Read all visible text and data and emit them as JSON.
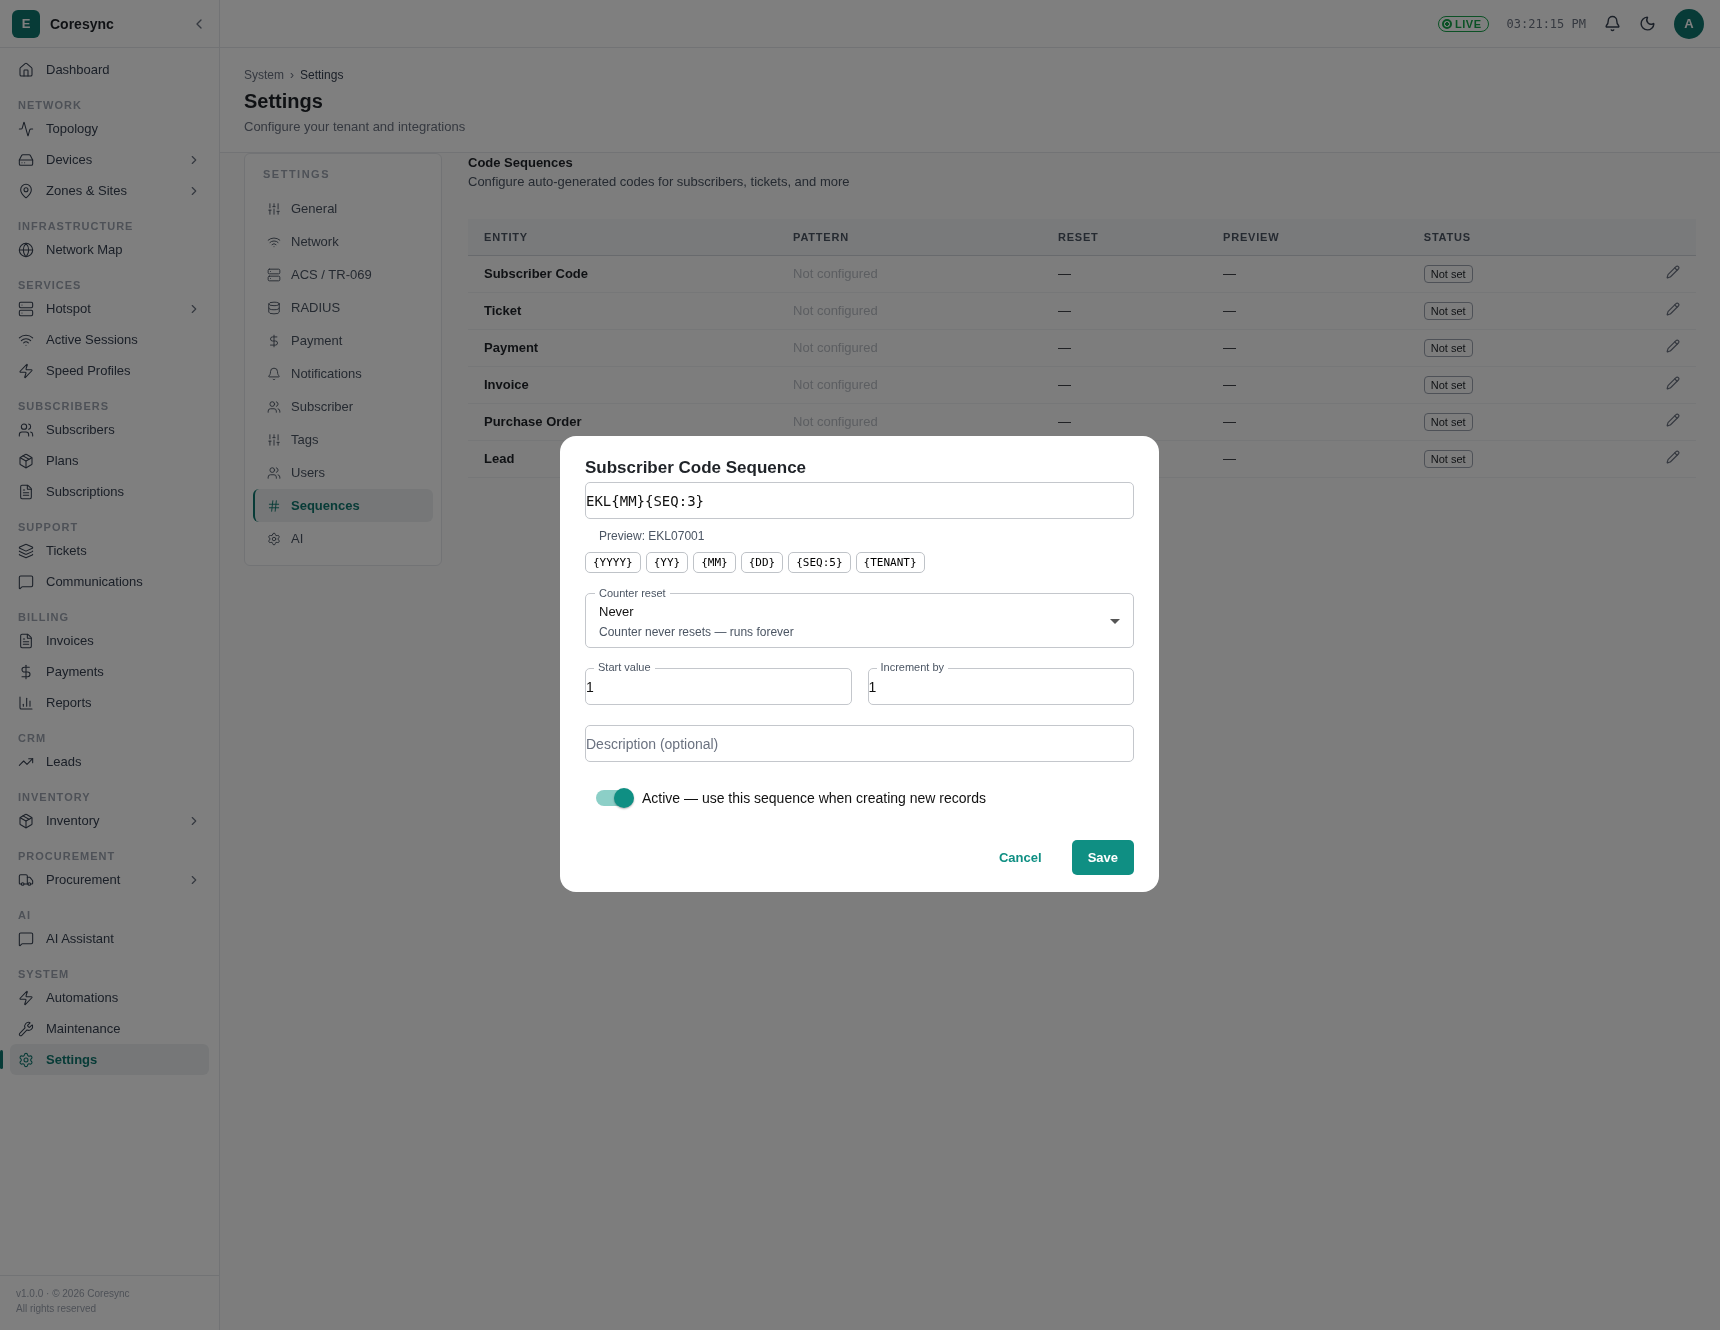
{
  "brand": {
    "initial": "E",
    "name": "Coresync"
  },
  "sidebar": {
    "sections": [
      {
        "items": [
          {
            "label": "Dashboard",
            "expandable": false,
            "selected": false
          }
        ]
      },
      {
        "heading": "NETWORK",
        "items": [
          {
            "label": "Topology",
            "expandable": false,
            "selected": false
          },
          {
            "label": "Devices",
            "expandable": true,
            "selected": false
          },
          {
            "label": "Zones & Sites",
            "expandable": true,
            "selected": false
          }
        ]
      },
      {
        "heading": "INFRASTRUCTURE",
        "items": [
          {
            "label": "Network Map",
            "expandable": false,
            "selected": false
          }
        ]
      },
      {
        "heading": "SERVICES",
        "items": [
          {
            "label": "Hotspot",
            "expandable": true,
            "selected": false
          },
          {
            "label": "Active Sessions",
            "expandable": false,
            "selected": false
          },
          {
            "label": "Speed Profiles",
            "expandable": false,
            "selected": false
          }
        ]
      },
      {
        "heading": "SUBSCRIBERS",
        "items": [
          {
            "label": "Subscribers",
            "expandable": false,
            "selected": false
          },
          {
            "label": "Plans",
            "expandable": false,
            "selected": false
          },
          {
            "label": "Subscriptions",
            "expandable": false,
            "selected": false
          }
        ]
      },
      {
        "heading": "SUPPORT",
        "items": [
          {
            "label": "Tickets",
            "expandable": false,
            "selected": false
          },
          {
            "label": "Communications",
            "expandable": false,
            "selected": false
          }
        ]
      },
      {
        "heading": "BILLING",
        "items": [
          {
            "label": "Invoices",
            "expandable": false,
            "selected": false
          },
          {
            "label": "Payments",
            "expandable": false,
            "selected": false
          },
          {
            "label": "Reports",
            "expandable": false,
            "selected": false
          }
        ]
      },
      {
        "heading": "CRM",
        "items": [
          {
            "label": "Leads",
            "expandable": false,
            "selected": false
          }
        ]
      },
      {
        "heading": "INVENTORY",
        "items": [
          {
            "label": "Inventory",
            "expandable": true,
            "selected": false
          }
        ]
      },
      {
        "heading": "PROCUREMENT",
        "items": [
          {
            "label": "Procurement",
            "expandable": true,
            "selected": false
          }
        ]
      },
      {
        "heading": "AI",
        "items": [
          {
            "label": "AI Assistant",
            "expandable": false,
            "selected": false
          }
        ]
      },
      {
        "heading": "SYSTEM",
        "items": [
          {
            "label": "Automations",
            "expandable": false,
            "selected": false
          },
          {
            "label": "Maintenance",
            "expandable": false,
            "selected": false
          },
          {
            "label": "Settings",
            "expandable": false,
            "selected": true
          }
        ]
      }
    ],
    "footer": {
      "version": "v1.0.0",
      "separator": "·",
      "copyright": "© 2026 Coresync",
      "rights": "All rights reserved"
    }
  },
  "topbar": {
    "live": "LIVE",
    "clock": "03:21:15 PM",
    "avatar": "A"
  },
  "breadcrumb": [
    "System",
    "Settings"
  ],
  "breadcrumb_separator": "›",
  "page": {
    "title": "Settings",
    "subtitle": "Configure your tenant and integrations"
  },
  "settings_nav": {
    "heading": "SETTINGS",
    "items": [
      {
        "label": "General",
        "selected": false
      },
      {
        "label": "Network",
        "selected": false
      },
      {
        "label": "ACS / TR-069",
        "selected": false
      },
      {
        "label": "RADIUS",
        "selected": false
      },
      {
        "label": "Payment",
        "selected": false
      },
      {
        "label": "Notifications",
        "selected": false
      },
      {
        "label": "Subscriber",
        "selected": false
      },
      {
        "label": "Tags",
        "selected": false
      },
      {
        "label": "Users",
        "selected": false
      },
      {
        "label": "Sequences",
        "selected": true
      },
      {
        "label": "AI",
        "selected": false
      }
    ]
  },
  "section": {
    "title": "Code Sequences",
    "description": "Configure auto-generated codes for subscribers, tickets, and more"
  },
  "table": {
    "columns": [
      "ENTITY",
      "PATTERN",
      "RESET",
      "PREVIEW",
      "STATUS"
    ],
    "rows": [
      {
        "entity": "Subscriber Code",
        "pattern": "Not configured",
        "reset": "—",
        "preview": "—",
        "status": "Not set"
      },
      {
        "entity": "Ticket",
        "pattern": "Not configured",
        "reset": "—",
        "preview": "—",
        "status": "Not set"
      },
      {
        "entity": "Payment",
        "pattern": "Not configured",
        "reset": "—",
        "preview": "—",
        "status": "Not set"
      },
      {
        "entity": "Invoice",
        "pattern": "Not configured",
        "reset": "—",
        "preview": "—",
        "status": "Not set"
      },
      {
        "entity": "Purchase Order",
        "pattern": "Not configured",
        "reset": "—",
        "preview": "—",
        "status": "Not set"
      },
      {
        "entity": "Lead",
        "preview": "—",
        "status": "Not set"
      }
    ]
  },
  "dialog": {
    "title": "Subscriber Code Sequence",
    "pattern": "EKL{MM}{SEQ:3}",
    "preview": "Preview: EKL07001",
    "tokens": [
      "{YYYY}",
      "{YY}",
      "{MM}",
      "{DD}",
      "{SEQ:5}",
      "{TENANT}"
    ],
    "counter_reset": {
      "label": "Counter reset",
      "value": "Never",
      "hint": "Counter never resets — runs forever"
    },
    "start_value": {
      "label": "Start value",
      "value": "1"
    },
    "increment": {
      "label": "Increment by",
      "value": "1"
    },
    "description": {
      "placeholder": "Description (optional)"
    },
    "active": {
      "on": true,
      "label": "Active — use this sequence when creating new records"
    },
    "buttons": {
      "cancel": "Cancel",
      "save": "Save"
    }
  }
}
